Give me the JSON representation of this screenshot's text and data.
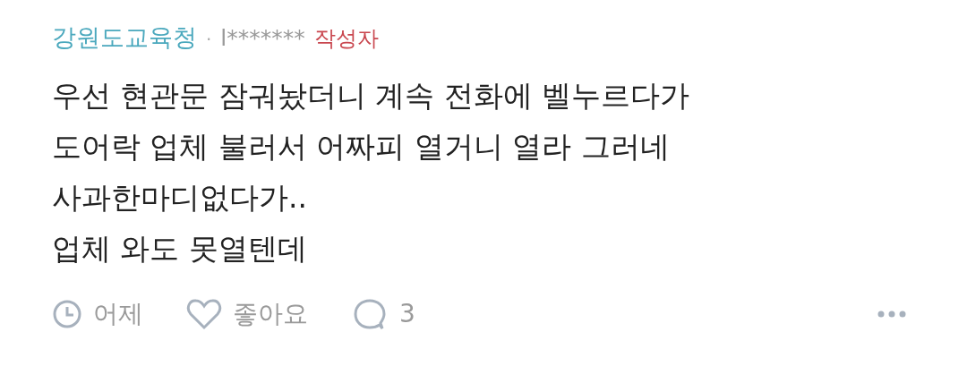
{
  "comment": {
    "author": "강원도교육청",
    "separator": "·",
    "user": "l*******",
    "badge": "작성자",
    "lines": [
      "우선 현관문 잠궈놨더니 계속 전화에 벨누르다가",
      "도어락 업체 불러서 어짜피 열거니 열라 그러네",
      "사과한마디없다가..",
      "업체 와도 못열텐데"
    ],
    "time": "어제",
    "like_label": "좋아요",
    "liked": false,
    "reply_count": "3"
  }
}
